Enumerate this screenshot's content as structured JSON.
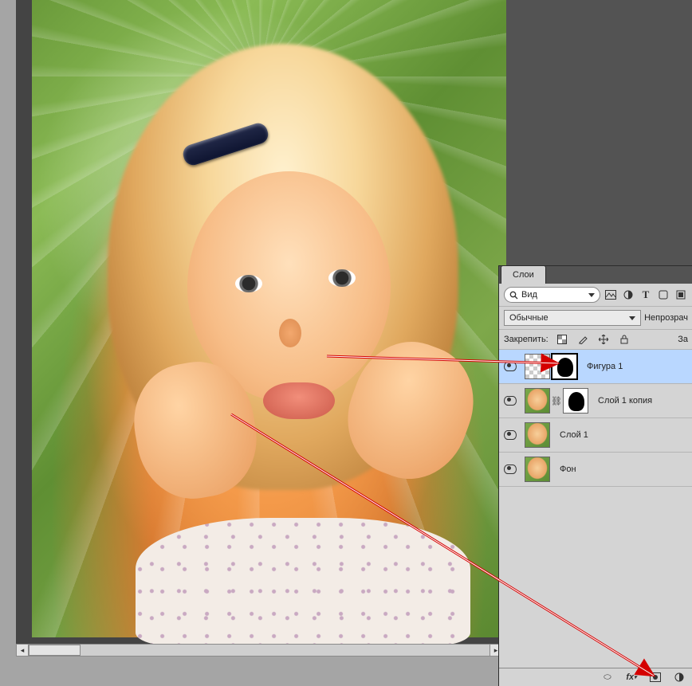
{
  "panel": {
    "tab_label": "Слои",
    "filter_value": "Вид",
    "filter_icons": [
      "image-filter-icon",
      "adjustment-filter-icon",
      "type-filter-icon",
      "shape-filter-icon",
      "smart-filter-icon"
    ],
    "blend_mode_value": "Обычные",
    "opacity_label_fragment": "Непрозрач",
    "lock_label": "Закрепить:",
    "fill_label_fragment": "За",
    "layers": [
      {
        "name": "Фигура 1",
        "visible": true,
        "selected": true,
        "thumbs": [
          "checker",
          "mask-selected"
        ]
      },
      {
        "name": "Слой 1 копия",
        "visible": true,
        "selected": false,
        "thumbs": [
          "photo",
          "link",
          "mask"
        ]
      },
      {
        "name": "Слой 1",
        "visible": true,
        "selected": false,
        "thumbs": [
          "photo"
        ]
      },
      {
        "name": "Фон",
        "visible": true,
        "selected": false,
        "thumbs": [
          "photo"
        ]
      }
    ],
    "bottom_icons": [
      "link-layers-icon",
      "fx-icon",
      "layer-mask-icon",
      "adjustment-layer-icon"
    ]
  },
  "canvas": {
    "description": "Photograph of a young child with blonde hair and a hair clip, chin resting on hands, green radial-blur background"
  }
}
